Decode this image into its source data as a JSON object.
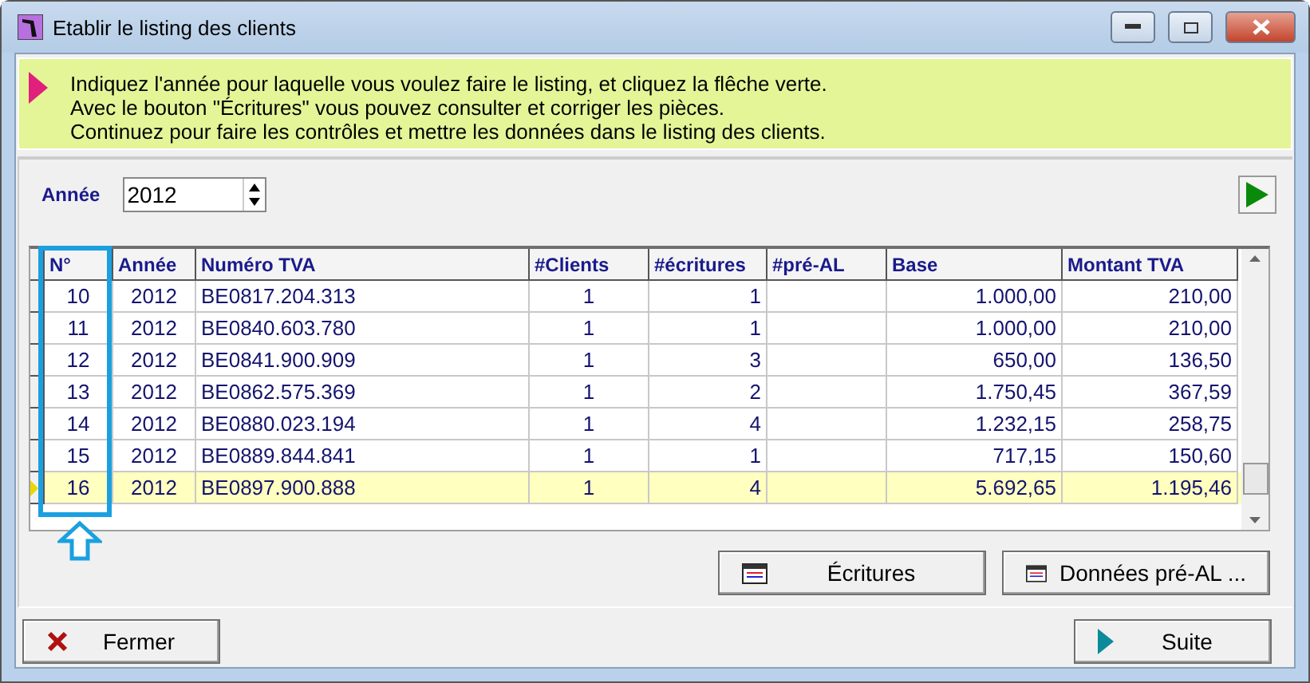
{
  "window": {
    "title": "Etablir le listing des clients"
  },
  "info": [
    "Indiquez l'année pour laquelle vous voulez faire le listing, et cliquez la flêche verte.",
    "Avec le bouton \"Écritures\" vous pouvez consulter et corriger les pièces.",
    "Continuez pour faire les contrôles et mettre les données dans le listing des clients."
  ],
  "year": {
    "label": "Année",
    "value": "2012"
  },
  "table": {
    "columns": [
      "N°",
      "Année",
      "Numéro TVA",
      "#Clients",
      "#écritures",
      "#pré-AL",
      "Base",
      "Montant TVA"
    ],
    "rows": [
      {
        "cells": [
          "10",
          "2012",
          "BE0817.204.313",
          "1",
          "1",
          "",
          "1.000,00",
          "210,00"
        ],
        "selected": false
      },
      {
        "cells": [
          "11",
          "2012",
          "BE0840.603.780",
          "1",
          "1",
          "",
          "1.000,00",
          "210,00"
        ],
        "selected": false
      },
      {
        "cells": [
          "12",
          "2012",
          "BE0841.900.909",
          "1",
          "3",
          "",
          "650,00",
          "136,50"
        ],
        "selected": false
      },
      {
        "cells": [
          "13",
          "2012",
          "BE0862.575.369",
          "1",
          "2",
          "",
          "1.750,45",
          "367,59"
        ],
        "selected": false
      },
      {
        "cells": [
          "14",
          "2012",
          "BE0880.023.194",
          "1",
          "4",
          "",
          "1.232,15",
          "258,75"
        ],
        "selected": false
      },
      {
        "cells": [
          "15",
          "2012",
          "BE0889.844.841",
          "1",
          "1",
          "",
          "717,15",
          "150,60"
        ],
        "selected": false
      },
      {
        "cells": [
          "16",
          "2012",
          "BE0897.900.888",
          "1",
          "4",
          "",
          "5.692,65",
          "1.195,46"
        ],
        "selected": true
      }
    ]
  },
  "panel_buttons": [
    "Écritures",
    "Données pré-AL ..."
  ],
  "footer_buttons": [
    {
      "label": "Fermer",
      "kind": "close"
    },
    {
      "label": "Suite",
      "kind": "next"
    }
  ]
}
